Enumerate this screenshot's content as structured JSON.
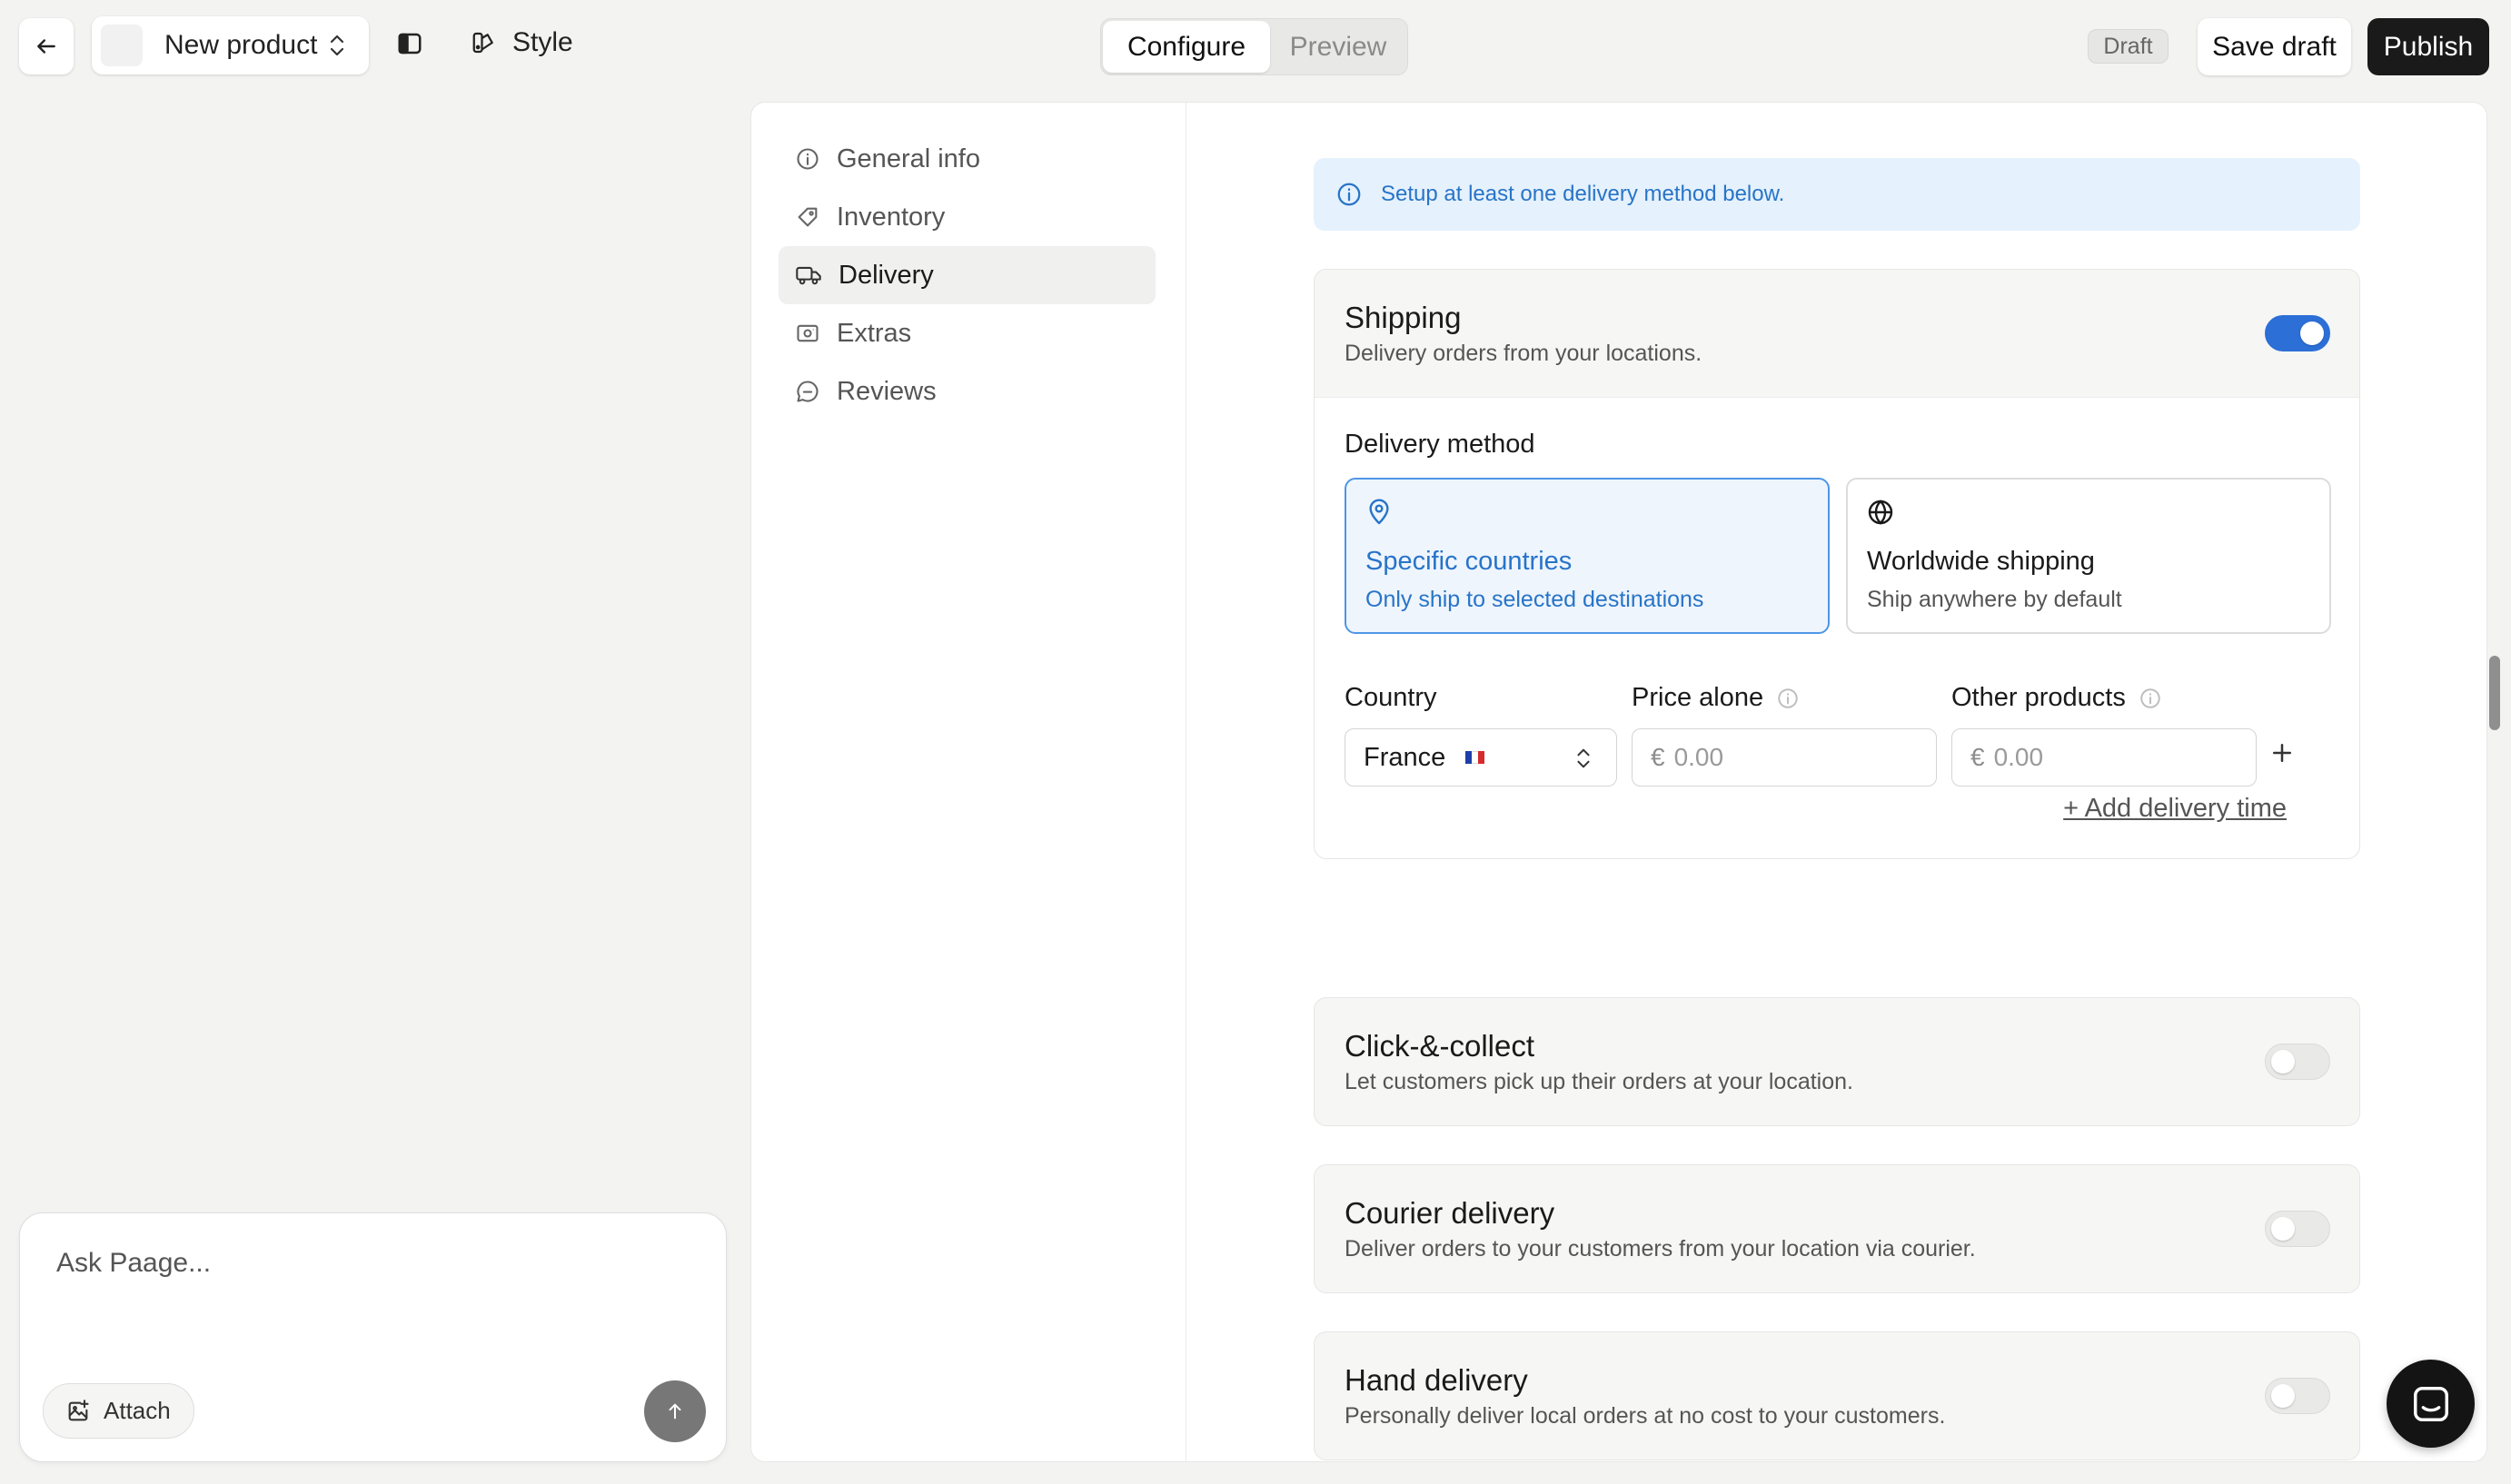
{
  "topbar": {
    "product_name": "New product",
    "style_label": "Style",
    "tabs": {
      "configure": "Configure",
      "preview": "Preview"
    },
    "status_badge": "Draft",
    "save_label": "Save draft",
    "publish_label": "Publish"
  },
  "chat": {
    "placeholder": "Ask Paage...",
    "attach_label": "Attach"
  },
  "nav": {
    "items": [
      {
        "label": "General info",
        "icon": "info-icon"
      },
      {
        "label": "Inventory",
        "icon": "tag-icon"
      },
      {
        "label": "Delivery",
        "icon": "truck-icon",
        "active": true
      },
      {
        "label": "Extras",
        "icon": "camera-icon"
      },
      {
        "label": "Reviews",
        "icon": "chat-bubble-icon"
      }
    ]
  },
  "banner": {
    "text": "Setup at least one delivery method below."
  },
  "shipping": {
    "title": "Shipping",
    "subtitle": "Delivery orders from your locations.",
    "enabled": true,
    "method_label": "Delivery method",
    "options": [
      {
        "title": "Specific countries",
        "subtitle": "Only ship to selected destinations",
        "icon": "map-pin-icon",
        "selected": true
      },
      {
        "title": "Worldwide shipping",
        "subtitle": "Ship anywhere by default",
        "icon": "globe-icon",
        "selected": false
      }
    ],
    "columns": {
      "country": "Country",
      "price_alone": "Price alone",
      "other_products": "Other products"
    },
    "row": {
      "country": "France",
      "currency": "€",
      "price_placeholder": "0.00",
      "other_placeholder": "0.00"
    },
    "add_delivery_time": "+ Add delivery time"
  },
  "methods": [
    {
      "title": "Click-&-collect",
      "subtitle": "Let customers pick up their orders at your location.",
      "enabled": false
    },
    {
      "title": "Courier delivery",
      "subtitle": "Deliver orders to your customers from your location via courier.",
      "enabled": false
    },
    {
      "title": "Hand delivery",
      "subtitle": "Personally deliver local orders at no cost to your customers.",
      "enabled": false
    }
  ],
  "colors": {
    "accent": "#2c6fd6",
    "banner_bg": "#e5f1fc",
    "publish_bg": "#1a1a1a",
    "flag_france": [
      "#1e3fa8",
      "#ffffff",
      "#d62b2b"
    ]
  }
}
